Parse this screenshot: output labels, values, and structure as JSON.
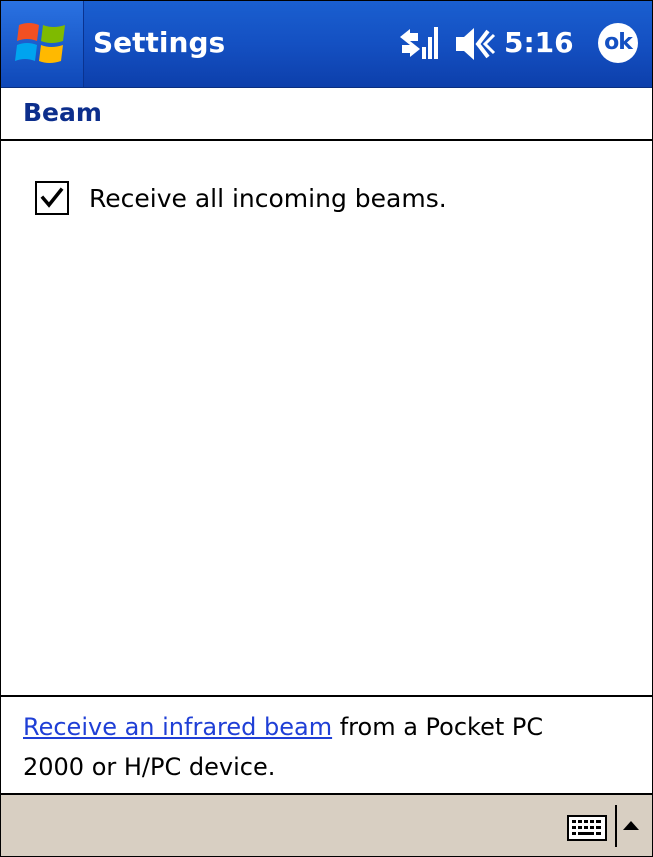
{
  "titlebar": {
    "app_title": "Settings",
    "clock": "5:16",
    "ok_label": "ok",
    "accent": "#1450c2"
  },
  "page": {
    "title": "Beam"
  },
  "content": {
    "checkbox_label": "Receive all incoming beams.",
    "checked": true
  },
  "footer": {
    "link_text": "Receive an infrared beam",
    "text_line1_rest": " from a Pocket PC",
    "text_line2": "2000 or H/PC device."
  },
  "menubar": {
    "keyboard_icon": "keyboard-icon",
    "sip_arrow_icon": "arrow-up-icon"
  }
}
